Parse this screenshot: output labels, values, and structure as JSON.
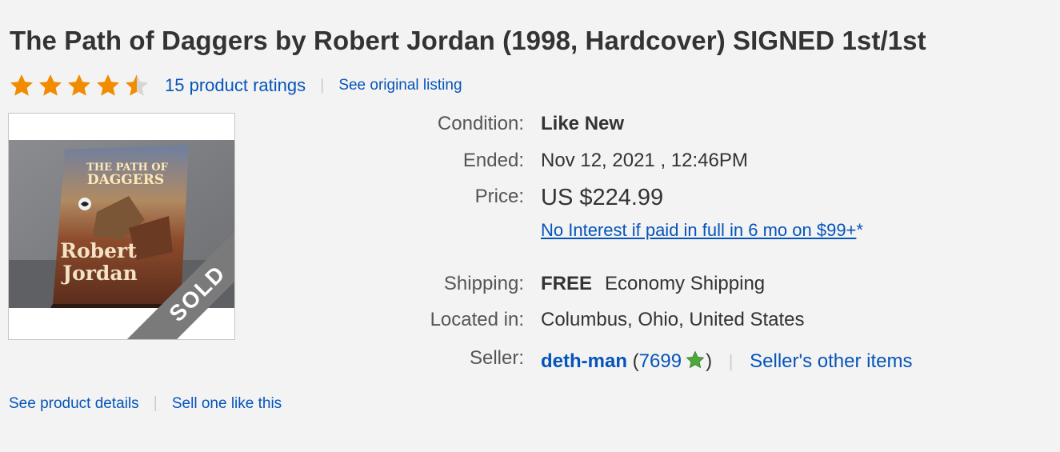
{
  "listing": {
    "title": "The Path of Daggers by Robert Jordan (1998, Hardcover) SIGNED 1st/1st",
    "rating": {
      "stars": 4.5,
      "ratings_text": "15 product ratings",
      "see_original": "See original listing"
    },
    "image": {
      "sold_label": "SOLD",
      "cover_title_line1": "THE PATH OF",
      "cover_title_line2": "DAGGERS",
      "cover_author_line1": "Robert",
      "cover_author_line2": "Jordan"
    },
    "details": {
      "condition_label": "Condition:",
      "condition_value": "Like New",
      "ended_label": "Ended:",
      "ended_value": "Nov 12, 2021 , 12:46PM",
      "price_label": "Price:",
      "price_value": "US $224.99",
      "promo_text": "No Interest if paid in full in 6 mo on $99+",
      "promo_asterisk": "*",
      "shipping_label": "Shipping:",
      "shipping_free": "FREE",
      "shipping_method": "Economy Shipping",
      "located_label": "Located in:",
      "located_value": "Columbus, Ohio, United States",
      "seller_label": "Seller:",
      "seller_name": "deth-man",
      "seller_open": "(",
      "seller_feedback": "7699",
      "seller_close": ")",
      "seller_other": "Seller's other items"
    },
    "bottom": {
      "product_details": "See product details",
      "sell_one": "Sell one like this"
    }
  },
  "colors": {
    "link": "#0654ba",
    "star": "#f18c00",
    "background": "#f3f3f3",
    "sold_ribbon": "#7a7a7a"
  },
  "icons": [
    "star-icon",
    "half-star-icon",
    "green-star-icon"
  ]
}
